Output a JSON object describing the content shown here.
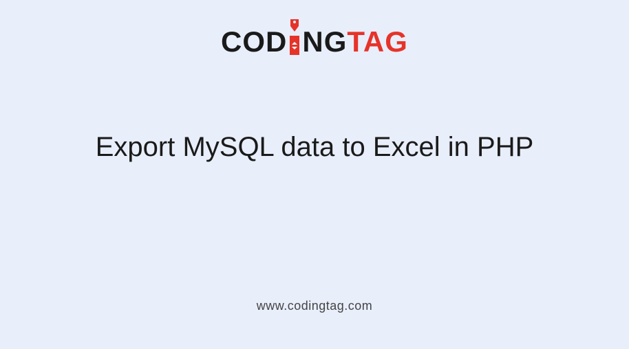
{
  "logo": {
    "word_part1": "COD",
    "word_part2": "NG",
    "word_red": "TAG"
  },
  "heading": {
    "text": "Export MySQL data to Excel in PHP"
  },
  "footer": {
    "url": "www.codingtag.com"
  }
}
